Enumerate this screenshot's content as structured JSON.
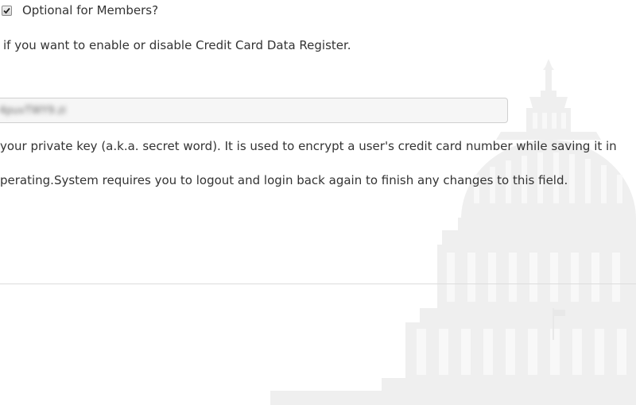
{
  "settings": {
    "optional_members": {
      "label": "Optional for Members?",
      "checked": true
    },
    "credit_card_help": "if you want to enable or disable Credit Card Data Register.",
    "private_key": {
      "value": "4puvTWY9.zi",
      "help_line1": "your private key (a.k.a. secret word). It is used to encrypt a user's credit card number while saving it in",
      "help_line2": "perating.System requires you to logout and login back again to finish any changes to this field."
    }
  }
}
